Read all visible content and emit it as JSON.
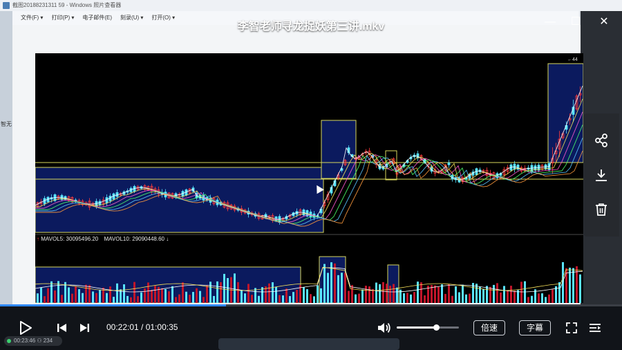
{
  "video": {
    "title": "李智老师寻龙捉妖第三讲.mkv",
    "current_time": "00:22:01",
    "separator": " / ",
    "total_time": "01:00:35",
    "progress_percent": 36.3,
    "volume_percent": 64,
    "speed_label": "倍速",
    "subtitle_label": "字幕"
  },
  "window_controls": {
    "minimize": "—",
    "maximize": "☐",
    "close": "✕"
  },
  "side_actions": [
    "share-icon",
    "download-icon",
    "delete-icon"
  ],
  "captured_window": {
    "title": "截图20188231311 59 - Windows 照片查看器",
    "menu": [
      "文件(F) ▾",
      "打印(P) ▾",
      "电子邮件(E)",
      "刻录(U) ▾",
      "打开(O) ▾"
    ]
  },
  "left_fragments": [
    "智无"
  ],
  "chart": {
    "mavol5_label": "MAVOL5: 30095496.20",
    "mavol5_arrow": "↑",
    "mavol10_label": "MAVOL10: 29090448.60",
    "mavol10_arrow": "↓",
    "top_right_marker": "44",
    "up_color": "#ff3b3b",
    "down_color": "#59e4ff",
    "box_color": "#d8d85c",
    "box_fill": "#0b1a5e"
  },
  "status": {
    "viewers": "00:23:46 ⚇ 234"
  }
}
